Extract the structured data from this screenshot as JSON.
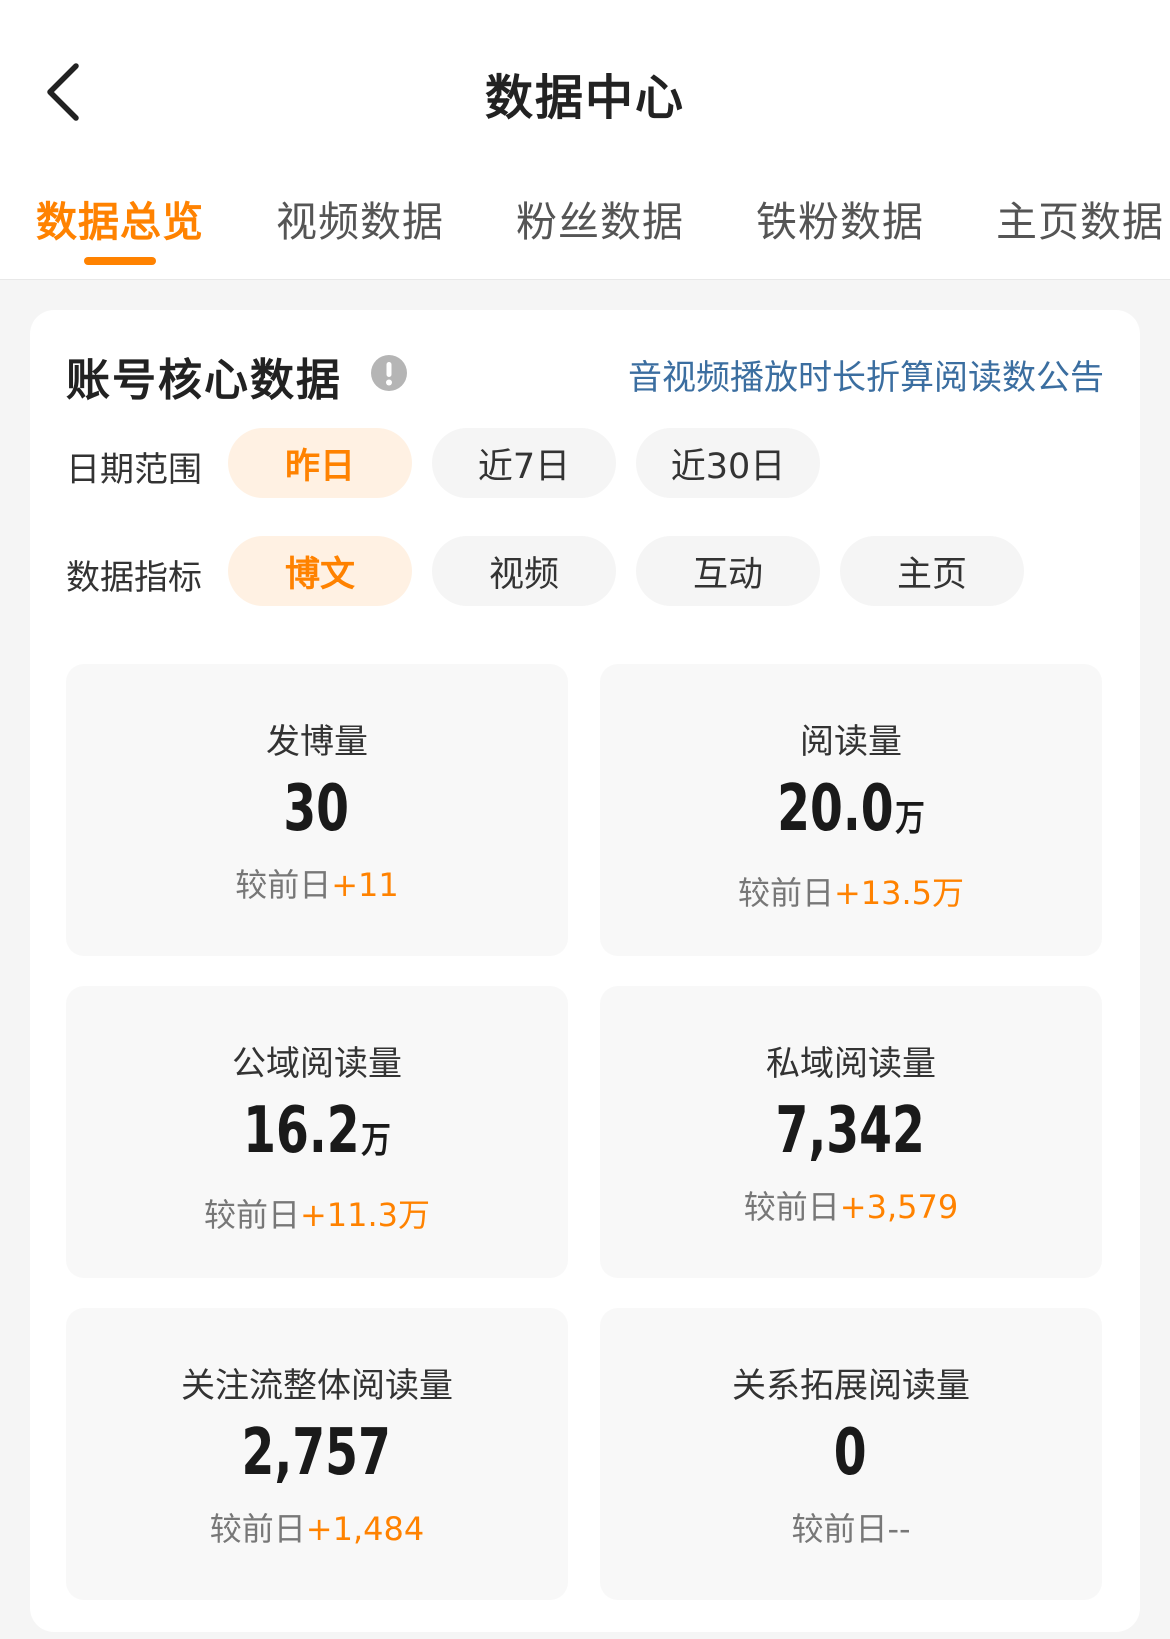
{
  "header": {
    "title": "数据中心"
  },
  "tabs": [
    {
      "label": "数据总览",
      "active": true
    },
    {
      "label": "视频数据",
      "active": false
    },
    {
      "label": "粉丝数据",
      "active": false
    },
    {
      "label": "铁粉数据",
      "active": false
    },
    {
      "label": "主页数据",
      "active": false
    }
  ],
  "section": {
    "title": "账号核心数据",
    "notice_link": "音视频播放时长折算阅读数公告"
  },
  "filters": {
    "date_range": {
      "label": "日期范围",
      "options": [
        "昨日",
        "近7日",
        "近30日"
      ],
      "selected": "昨日"
    },
    "metric": {
      "label": "数据指标",
      "options": [
        "博文",
        "视频",
        "互动",
        "主页"
      ],
      "selected": "博文"
    }
  },
  "stats": [
    {
      "label": "发博量",
      "value": "30",
      "unit": "",
      "compare_prefix": "较前日",
      "delta": "+11"
    },
    {
      "label": "阅读量",
      "value": "20.0",
      "unit": "万",
      "compare_prefix": "较前日",
      "delta": "+13.5万"
    },
    {
      "label": "公域阅读量",
      "value": "16.2",
      "unit": "万",
      "compare_prefix": "较前日",
      "delta": "+11.3万"
    },
    {
      "label": "私域阅读量",
      "value": "7,342",
      "unit": "",
      "compare_prefix": "较前日",
      "delta": "+3,579"
    },
    {
      "label": "关注流整体阅读量",
      "value": "2,757",
      "unit": "",
      "compare_prefix": "较前日",
      "delta": "+1,484"
    },
    {
      "label": "关系拓展阅读量",
      "value": "0",
      "unit": "",
      "compare_prefix": "较前日",
      "delta": "--"
    }
  ],
  "colors": {
    "accent": "#ff8200",
    "link": "#3b6ea0",
    "chip_active_bg": "#fff1e3"
  }
}
